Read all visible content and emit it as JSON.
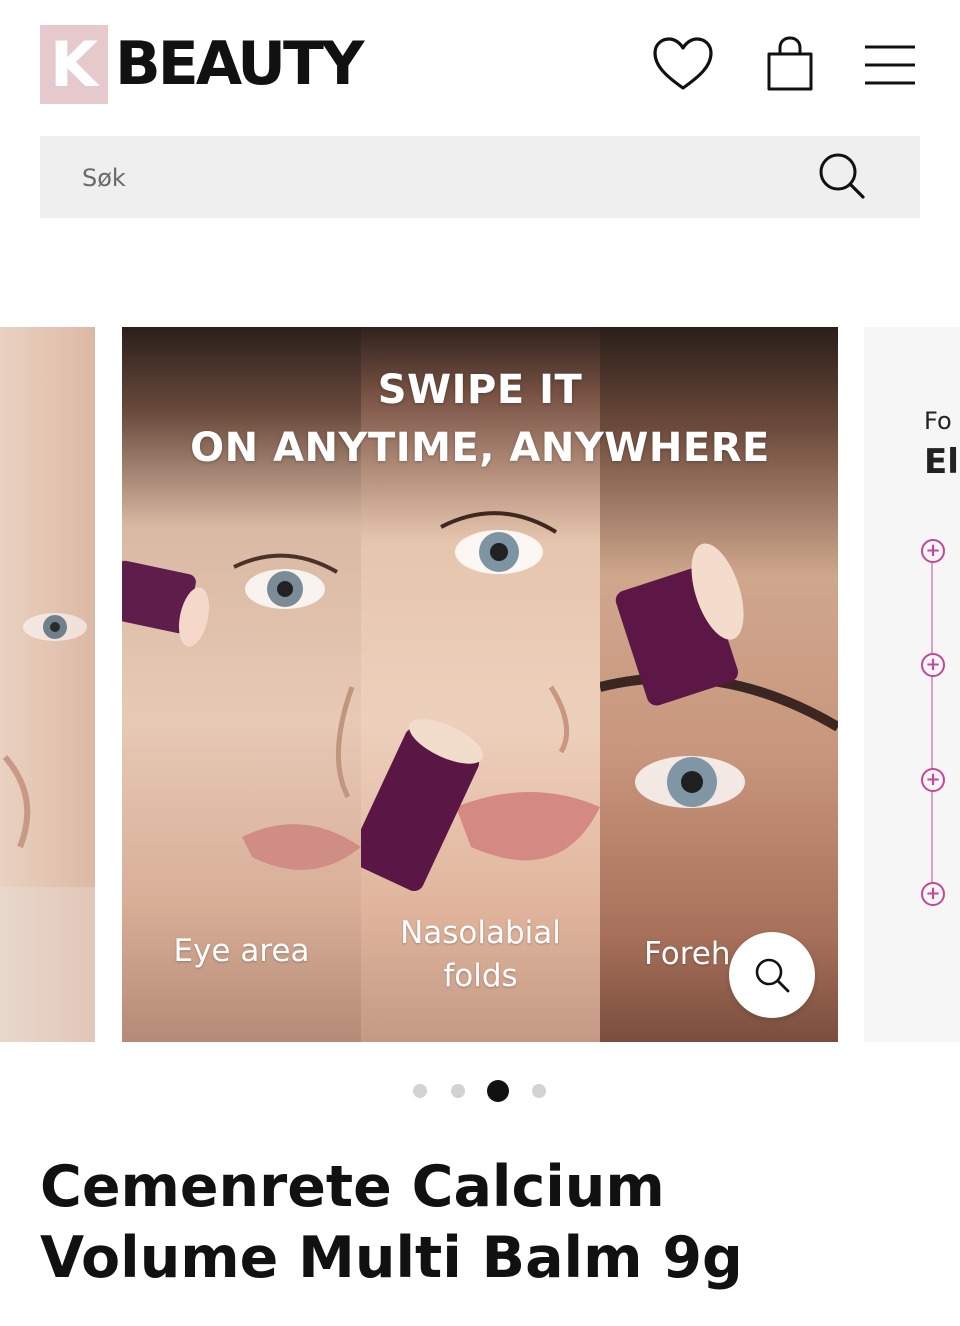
{
  "header": {
    "logo_k": "K",
    "logo_word": "BEAUTY",
    "icons": [
      "heart-icon",
      "shopping-bag-icon",
      "menu-icon"
    ]
  },
  "search": {
    "placeholder": "Søk",
    "icon": "search-icon"
  },
  "carousel": {
    "headline_line1": "SWIPE IT",
    "headline_line2": "ON ANYTIME, ANYWHERE",
    "captions": {
      "eye": "Eye area",
      "nasolabial_1": "Nasolabial",
      "nasolabial_2": "folds",
      "forehead": "Foreh"
    },
    "next_slide": {
      "small": "Fo",
      "big": "El"
    },
    "zoom_icon": "search-icon",
    "dots_total": 4,
    "active_dot_index": 2
  },
  "product": {
    "title_line1": "Cemenrete Calcium",
    "title_line2": "Volume Multi Balm 9g"
  },
  "colors": {
    "logo_k_bg": "#e6c9cc",
    "search_bg": "#efefef",
    "accent_pink": "#c4479a",
    "text": "#111111"
  }
}
